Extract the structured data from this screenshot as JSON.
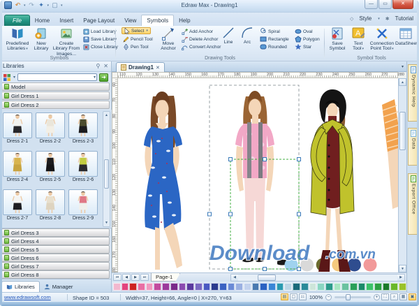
{
  "window": {
    "title": "Edraw Max - Drawing1"
  },
  "tabs": {
    "items": [
      "File",
      "Home",
      "Insert",
      "Page Layout",
      "View",
      "Symbols",
      "Help"
    ],
    "active": "Symbols",
    "style": "Style",
    "tutorial": "Tutorial"
  },
  "ribbon": {
    "predefined": "Predefined Libraries",
    "new_library": "New Library",
    "create_library": "Create Library From Images...",
    "load_library": "Load Library",
    "save_library": "Save Library",
    "close_library": "Close Library",
    "select": "Select",
    "pencil": "Pencil Tool",
    "pen": "Pen Tool",
    "move_anchor": "Move Anchor",
    "add_anchor": "Add Anchor",
    "delete_anchor": "Delete Anchor",
    "convert_anchor": "Convert Anchor",
    "line": "Line",
    "arc": "Arc",
    "spiral": "Spiral",
    "rectangle": "Rectangle",
    "rounded": "Rounded",
    "oval": "Oval",
    "polygon": "Polygon",
    "star": "Star",
    "save_symbol": "Save Symbol",
    "text_tool": "Text Tool",
    "connection_point": "Connection Point Tool",
    "datasheet": "DataSheet",
    "group_symbols": "Symbols",
    "group_drawing": "Drawing Tools",
    "group_symbol_tools": "Symbol Tools"
  },
  "libraries_panel": {
    "title": "Libraries",
    "bars_top": [
      "Model",
      "Girl Dress 1",
      "Girl Dress 2"
    ],
    "thumbs": [
      {
        "label": "Dress 2-1",
        "top": "#f2f2ee",
        "bottom": "#26262a",
        "hair": "#2e2018"
      },
      {
        "label": "Dress 2-2",
        "top": "#eae6da",
        "bottom": "#f2efe6",
        "hair": "#c8b89a"
      },
      {
        "label": "Dress 2-3",
        "top": "#4c4c2e",
        "bottom": "#1c1c1e",
        "hair": "#2e2018"
      },
      {
        "label": "Dress 2-4",
        "top": "#d8b44e",
        "bottom": "#c8a441",
        "hair": "#3a2a1a"
      },
      {
        "label": "Dress 2-5",
        "top": "#1c1c1e",
        "bottom": "#141416",
        "hair": "#2e2018"
      },
      {
        "label": "Dress 2-6",
        "top": "#c2cc42",
        "bottom": "#2a2a2e",
        "hair": "#3a2a1a"
      },
      {
        "label": "Dress 2-7",
        "top": "#f4f4f2",
        "bottom": "#1e1e22",
        "hair": "#2e2018"
      },
      {
        "label": "Dress 2-8",
        "top": "#e8e0ce",
        "bottom": "#ded4c0",
        "hair": "#3a2a1a"
      },
      {
        "label": "Dress 2-9",
        "top": "#e07886",
        "bottom": "#f0f0ec",
        "hair": "#2e2018"
      }
    ],
    "bars_bottom": [
      "Girl Dress 3",
      "Girl Dress 4",
      "Girl Dress 5",
      "Girl Dress 6",
      "Girl Dress 7",
      "Girl Dress 8"
    ],
    "tab_libraries": "Libraries",
    "tab_manager": "Manager"
  },
  "canvas": {
    "doc_tab": "Drawing1",
    "page_tab": "Page-1",
    "h_ruler": [
      110,
      120,
      130,
      140,
      150,
      160,
      170,
      180,
      190,
      200,
      210,
      220,
      230,
      240,
      250,
      260,
      270,
      280
    ],
    "v_ruler": [
      60,
      70,
      80,
      90,
      100,
      110,
      120,
      130,
      140,
      150,
      160,
      170,
      180
    ],
    "watermark": {
      "main": "Download",
      "suffix": ".com.vn"
    },
    "swatch_circles": [
      "#9fd2ef",
      "#d9d9d9",
      "#6b6b2f",
      "#f5c97e",
      "#2f4d8f",
      "#f29a9a"
    ]
  },
  "side_tabs": [
    "Dynamic Help",
    "Data",
    "Export Office"
  ],
  "palette": [
    "#f2b8cf",
    "#e2447e",
    "#cc2222",
    "#e86ea4",
    "#f09ac0",
    "#c24a9e",
    "#9b3a9b",
    "#7a2a8a",
    "#8a4ab0",
    "#5a3a9e",
    "#7a6ac2",
    "#4a5ac2",
    "#2a3a8e",
    "#3a62c2",
    "#6a8ad6",
    "#9ab0e2",
    "#c2d2ee",
    "#4a7ab0",
    "#2a62c2",
    "#3a86d6",
    "#2a9ab0",
    "#bcd6e6",
    "#1a6a7a",
    "#2a8a9a",
    "#cde6da",
    "#8ad6c2",
    "#2a9a8a",
    "#a8e6c2",
    "#6ac2a0",
    "#2aa05a",
    "#1a8a6a",
    "#3ac26a",
    "#2aa042",
    "#1a7a2a",
    "#6ab82a",
    "#9ac22a"
  ],
  "statusbar": {
    "link": "www.edrawsoft.com",
    "shape_id": "Shape ID = 503",
    "dims": "Width=37, Height=66, Angle=0 | X=270, Y=63",
    "zoom": "100%"
  }
}
